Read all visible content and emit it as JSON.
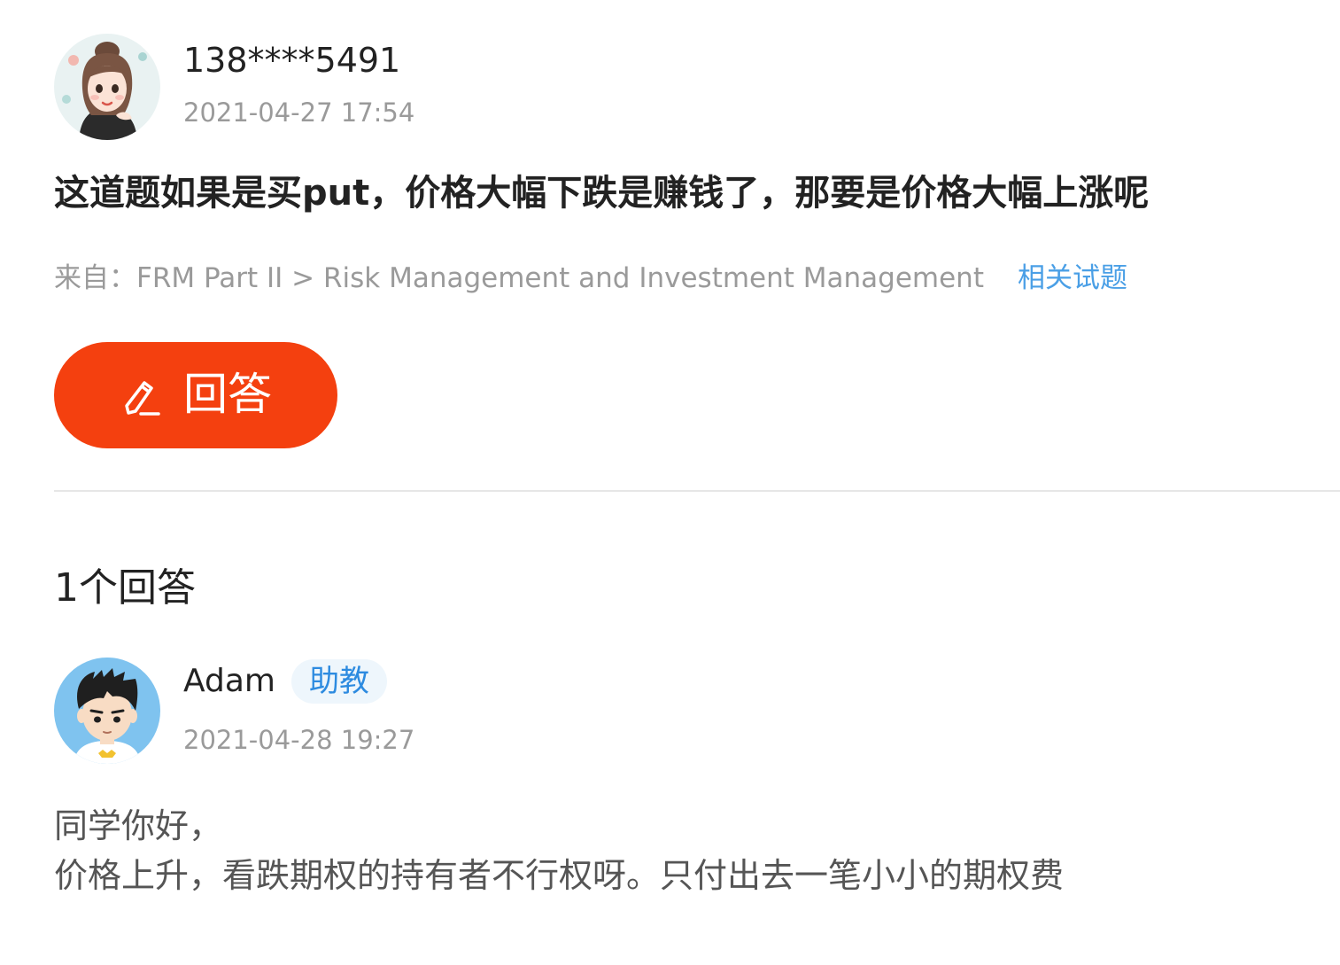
{
  "question": {
    "user": {
      "name": "138****5491",
      "time": "2021-04-27 17:54"
    },
    "title": "这道题如果是买put，价格大幅下跌是赚钱了，那要是价格大幅上涨呢",
    "source": {
      "label": "来自：",
      "path": "FRM Part II > Risk Management and Investment Management",
      "related_link": "相关试题"
    },
    "answer_button": "回答"
  },
  "answers": {
    "count_label": "1个回答",
    "items": [
      {
        "name": "Adam",
        "badge": "助教",
        "time": "2021-04-28 19:27",
        "lines": [
          "同学你好，",
          "价格上升，看跌期权的持有者不行权呀。只付出去一笔小小的期权费"
        ]
      }
    ]
  },
  "colors": {
    "accent": "#f4400f",
    "link": "#4a9fe6",
    "badge_text": "#2d8be0",
    "badge_bg": "#eef6fc",
    "muted": "#9a9a9a",
    "divider": "#e6e6e6"
  },
  "icons": {
    "answer_button_icon": "pen-icon",
    "asker_avatar": "avatar-girl",
    "answerer_avatar": "avatar-boy"
  }
}
